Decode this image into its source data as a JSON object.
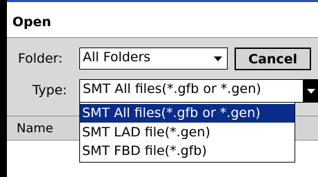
{
  "dialog": {
    "title": "Open"
  },
  "folder": {
    "label": "Folder:",
    "value": "All Folders",
    "arrow_icon": "chevron-down-icon"
  },
  "cancel_label": "Cancel",
  "type": {
    "label": "Type:",
    "value": "SMT All files(*.gfb or *.gen)",
    "arrow_icon": "chevron-down-icon"
  },
  "list_header": {
    "name": "Name"
  },
  "dropdown": {
    "options": [
      "SMT All files(*.gfb or *.gen)",
      "SMT LAD file(*.gen)",
      "SMT FBD file(*.gfb)"
    ],
    "selected_index": 0
  },
  "colors": {
    "title_accent": "#2d4bc8",
    "selection_bg": "#0a2c8a",
    "panel_bg": "#d8d8d8"
  }
}
